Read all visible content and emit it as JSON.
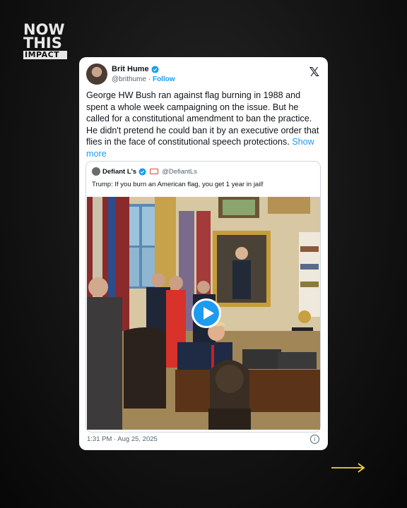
{
  "logo": {
    "line1": "NOW",
    "line2": "THIS",
    "line3": "IMPACT"
  },
  "tweet": {
    "author_name": "Brit Hume",
    "handle": "@brithume",
    "separator": "·",
    "follow_label": "Follow",
    "text": "George HW Bush ran against flag burning in 1988 and spent a whole week campaigning on the issue. But he called for a constitutional amendment to ban the practice. He didn't pretend he could ban it by an executive order that flies in the face of constitutional speech protections.",
    "show_more_label": "Show more",
    "timestamp": "1:31 PM · Aug 25, 2025",
    "info_glyph": "i"
  },
  "quoted": {
    "author_name": "Defiant L's",
    "handle": "@DefiantLs",
    "text": "Trump: If you burn an American flag, you get 1 year in jail!"
  },
  "icons": {
    "x_logo": "𝕏"
  },
  "colors": {
    "accent": "#1d9bf0",
    "arrow": "#f2d43a",
    "background": "#141414"
  }
}
